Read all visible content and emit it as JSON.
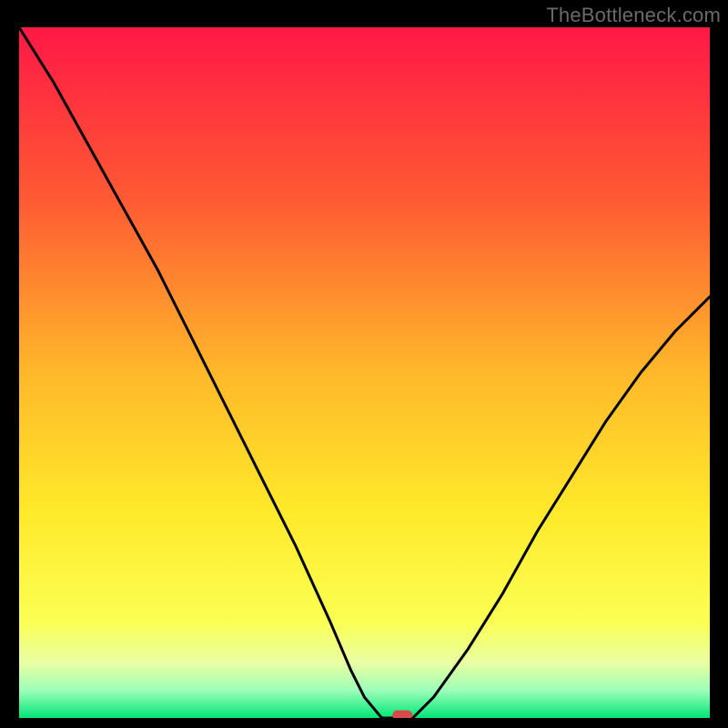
{
  "watermark": "TheBottleneck.com",
  "chart_data": {
    "type": "line",
    "title": "",
    "xlabel": "",
    "ylabel": "",
    "xlim": [
      0,
      100
    ],
    "ylim": [
      0,
      100
    ],
    "grid": false,
    "x": [
      0,
      5,
      10,
      15,
      20,
      25,
      30,
      35,
      40,
      45,
      48,
      50,
      52.5,
      55,
      57,
      60,
      65,
      70,
      75,
      80,
      85,
      90,
      95,
      100
    ],
    "values": [
      100,
      92,
      83,
      74,
      65,
      55,
      45,
      35,
      25,
      14,
      7,
      3,
      0,
      0,
      0,
      3,
      10,
      18,
      27,
      35,
      43,
      50,
      56,
      61
    ],
    "marker": {
      "x": 55.5,
      "y": 0
    },
    "gradient_stops": [
      {
        "pos": 0.0,
        "color": "#ff1846"
      },
      {
        "pos": 0.25,
        "color": "#ff5a33"
      },
      {
        "pos": 0.5,
        "color": "#ffb82a"
      },
      {
        "pos": 0.7,
        "color": "#ffe92a"
      },
      {
        "pos": 0.86,
        "color": "#fbff53"
      },
      {
        "pos": 0.92,
        "color": "#e9ffa3"
      },
      {
        "pos": 0.96,
        "color": "#9dffb9"
      },
      {
        "pos": 1.0,
        "color": "#00e676"
      }
    ]
  }
}
